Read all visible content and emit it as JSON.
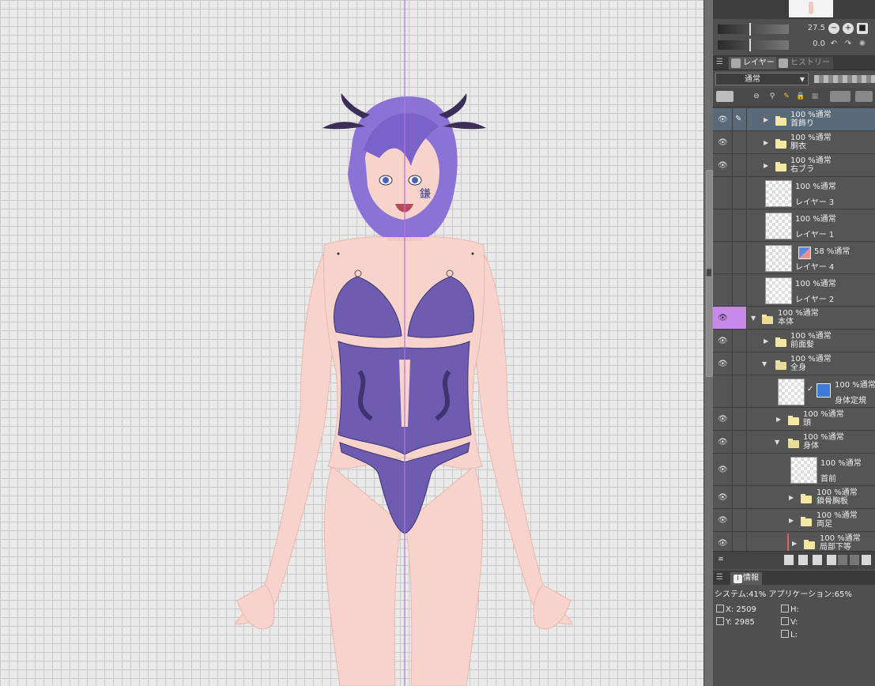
{
  "navigator": {
    "zoom_value": "27.5",
    "rotate_value": "0.0",
    "zoom_out_icon": "zoom-out-icon",
    "zoom_in_icon": "zoom-in-icon",
    "fit_icon": "fit-icon",
    "rotate_left_icon": "rotate-left-icon",
    "rotate_right_icon": "rotate-right-icon",
    "reset_icon": "reset-rotate-icon"
  },
  "layer_panel": {
    "tabs": [
      {
        "label": "レイヤー",
        "active": true
      },
      {
        "label": "ヒストリー",
        "active": false
      }
    ],
    "blend_mode": "通常",
    "layers": [
      {
        "mode": "100 %通常",
        "name": "首飾り",
        "type": "folder",
        "selected": true
      },
      {
        "mode": "100 %通常",
        "name": "胴衣",
        "type": "folder"
      },
      {
        "mode": "100 %通常",
        "name": "右ブラ",
        "type": "folder"
      },
      {
        "mode": "100 %通常",
        "name": "レイヤー 3",
        "type": "raster"
      },
      {
        "mode": "100 %通常",
        "name": "レイヤー 1",
        "type": "raster"
      },
      {
        "mode": "58 %通常",
        "name": "レイヤー 4",
        "type": "raster"
      },
      {
        "mode": "100 %通常",
        "name": "レイヤー 2",
        "type": "raster"
      },
      {
        "mode": "100 %通常",
        "name": "本体",
        "type": "folder-open"
      },
      {
        "mode": "100 %通常",
        "name": "前面髪",
        "type": "folder"
      },
      {
        "mode": "100 %通常",
        "name": "全身",
        "type": "folder-open"
      },
      {
        "mode": "100 %通常",
        "name": "身体定規",
        "type": "ruler"
      },
      {
        "mode": "100 %通常",
        "name": "頭",
        "type": "folder"
      },
      {
        "mode": "100 %通常",
        "name": "身体",
        "type": "folder-open"
      },
      {
        "mode": "100 %通常",
        "name": "首前",
        "type": "raster"
      },
      {
        "mode": "100 %通常",
        "name": "鎖骨胸板",
        "type": "folder"
      },
      {
        "mode": "100 %通常",
        "name": "両足",
        "type": "folder"
      },
      {
        "mode": "100 %通常",
        "name": "局部下等",
        "type": "folder"
      }
    ]
  },
  "info_panel": {
    "tab_label": "情報",
    "system_usage": "システム:41%",
    "app_usage": "アプリケーション:65%",
    "x_label": "X:",
    "x_value": "2509",
    "y_label": "Y:",
    "y_value": "2985",
    "h_label": "H:",
    "v_label": "V:",
    "l_label": "L:"
  },
  "canvas": {
    "face_glyph": "鎌",
    "guide_color": "#b56fe0",
    "outfit_color": "#6e5cb0",
    "skin_color": "#f7d3cb",
    "hair_color": "#8b72d6"
  }
}
